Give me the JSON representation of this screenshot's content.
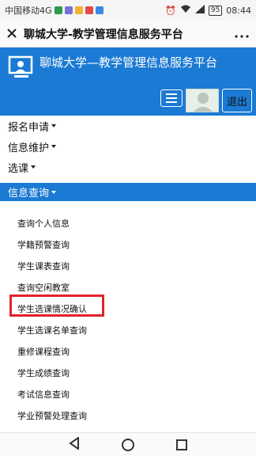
{
  "status_bar": {
    "carrier": "中国移动4G",
    "battery": "95",
    "time": "08:44"
  },
  "title_bar": {
    "close_icon": "close-icon",
    "title": "聊城大学-教学管理信息服务平台",
    "more_icon": "more-icon"
  },
  "header": {
    "title": "聊城大学—教学管理信息服务平台",
    "menu_icon": "hamburger-icon",
    "exit_label": "退出",
    "accent": "#1b7ad3"
  },
  "nav": {
    "items": [
      {
        "label": "报名申请"
      },
      {
        "label": "信息维护"
      },
      {
        "label": "选课"
      },
      {
        "label": "信息查询"
      }
    ]
  },
  "submenu": {
    "items": [
      {
        "label": "查询个人信息"
      },
      {
        "label": "学籍预警查询"
      },
      {
        "label": "学生课表查询"
      },
      {
        "label": "查询空闲教室"
      },
      {
        "label": "学生选课情况确认"
      },
      {
        "label": "学生选课名单查询"
      },
      {
        "label": "重修课程查询"
      },
      {
        "label": "学生成绩查询"
      },
      {
        "label": "考试信息查询"
      },
      {
        "label": "学业预警处理查询"
      }
    ],
    "highlight_color": "#e0232b"
  }
}
